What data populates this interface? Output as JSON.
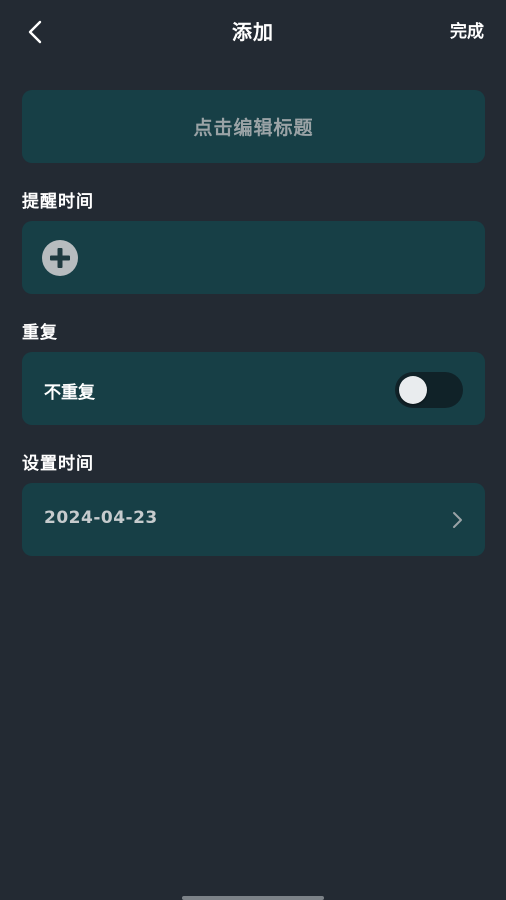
{
  "header": {
    "title": "添加",
    "done_label": "完成",
    "back_icon": "chevron-left-icon"
  },
  "title_field": {
    "placeholder": "点击编辑标题"
  },
  "remind_section": {
    "label": "提醒时间",
    "add_icon": "plus-circle-icon"
  },
  "repeat_section": {
    "label": "重复",
    "value_label": "不重复",
    "toggle_on": false
  },
  "date_section": {
    "label": "设置时间",
    "value": "2024-04-23",
    "chevron_icon": "chevron-right-icon"
  },
  "colors": {
    "background": "#232a33",
    "card": "#173f46",
    "text": "#ffffff",
    "muted_text": "#9aa3a6"
  }
}
